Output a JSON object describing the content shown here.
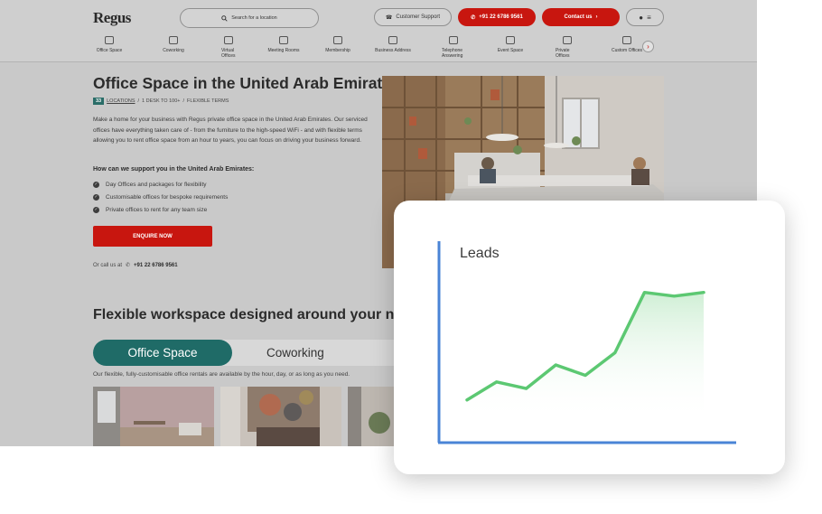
{
  "header": {
    "logo": "Regus",
    "search_placeholder": "Search for a location",
    "support_label": "Customer Support",
    "phone_label": "+91 22 6786 9561",
    "contact_label": "Contact us"
  },
  "nav": {
    "items": [
      "Office Space",
      "Coworking",
      "Virtual Offices",
      "Meeting Rooms",
      "Membership",
      "Business Address",
      "Telephone Answering",
      "Event Space",
      "Private Offices",
      "Custom Offices"
    ]
  },
  "hero": {
    "title": "Office Space in the United Arab Emirates",
    "title_dot": ".",
    "locations_count": "33",
    "locations_label": "LOCATIONS",
    "desk_label": "1 DESK TO 100+",
    "terms_label": "FLEXIBLE TERMS",
    "separator": "/",
    "intro": "Make a home for your business with Regus private office space in the United Arab Emirates. Our serviced offices have everything taken care of - from the furniture to the high-speed WiFi - and with flexible terms allowing you to rent office space from an hour to years, you can focus on driving your business forward.",
    "support_heading": "How can we support you in the United Arab Emirates:",
    "checks": [
      "Day Offices and packages for flexibility",
      "Customisable offices for bespoke requirements",
      "Private offices to rent for any team size"
    ],
    "cta_label": "ENQUIRE NOW",
    "call_label": "Or call us at",
    "call_number": "+91 22 6786 9561"
  },
  "workspace": {
    "heading": "Flexible workspace designed around your ne",
    "tabs": [
      "Office Space",
      "Coworking"
    ],
    "description": "Our flexible, fully-customisable office rentals are available by the hour, day, or as long as you need."
  },
  "chart_data": {
    "type": "area",
    "title": "Leads",
    "x": [
      1,
      2,
      3,
      4,
      5,
      6,
      7,
      8,
      9
    ],
    "values": [
      8,
      27,
      20,
      45,
      34,
      58,
      122,
      118,
      122
    ],
    "ylim": [
      0,
      160
    ],
    "line_color": "#5cc872",
    "fill_color": "#d8f3dd",
    "axis_color": "#4a84d6",
    "grid": false
  }
}
